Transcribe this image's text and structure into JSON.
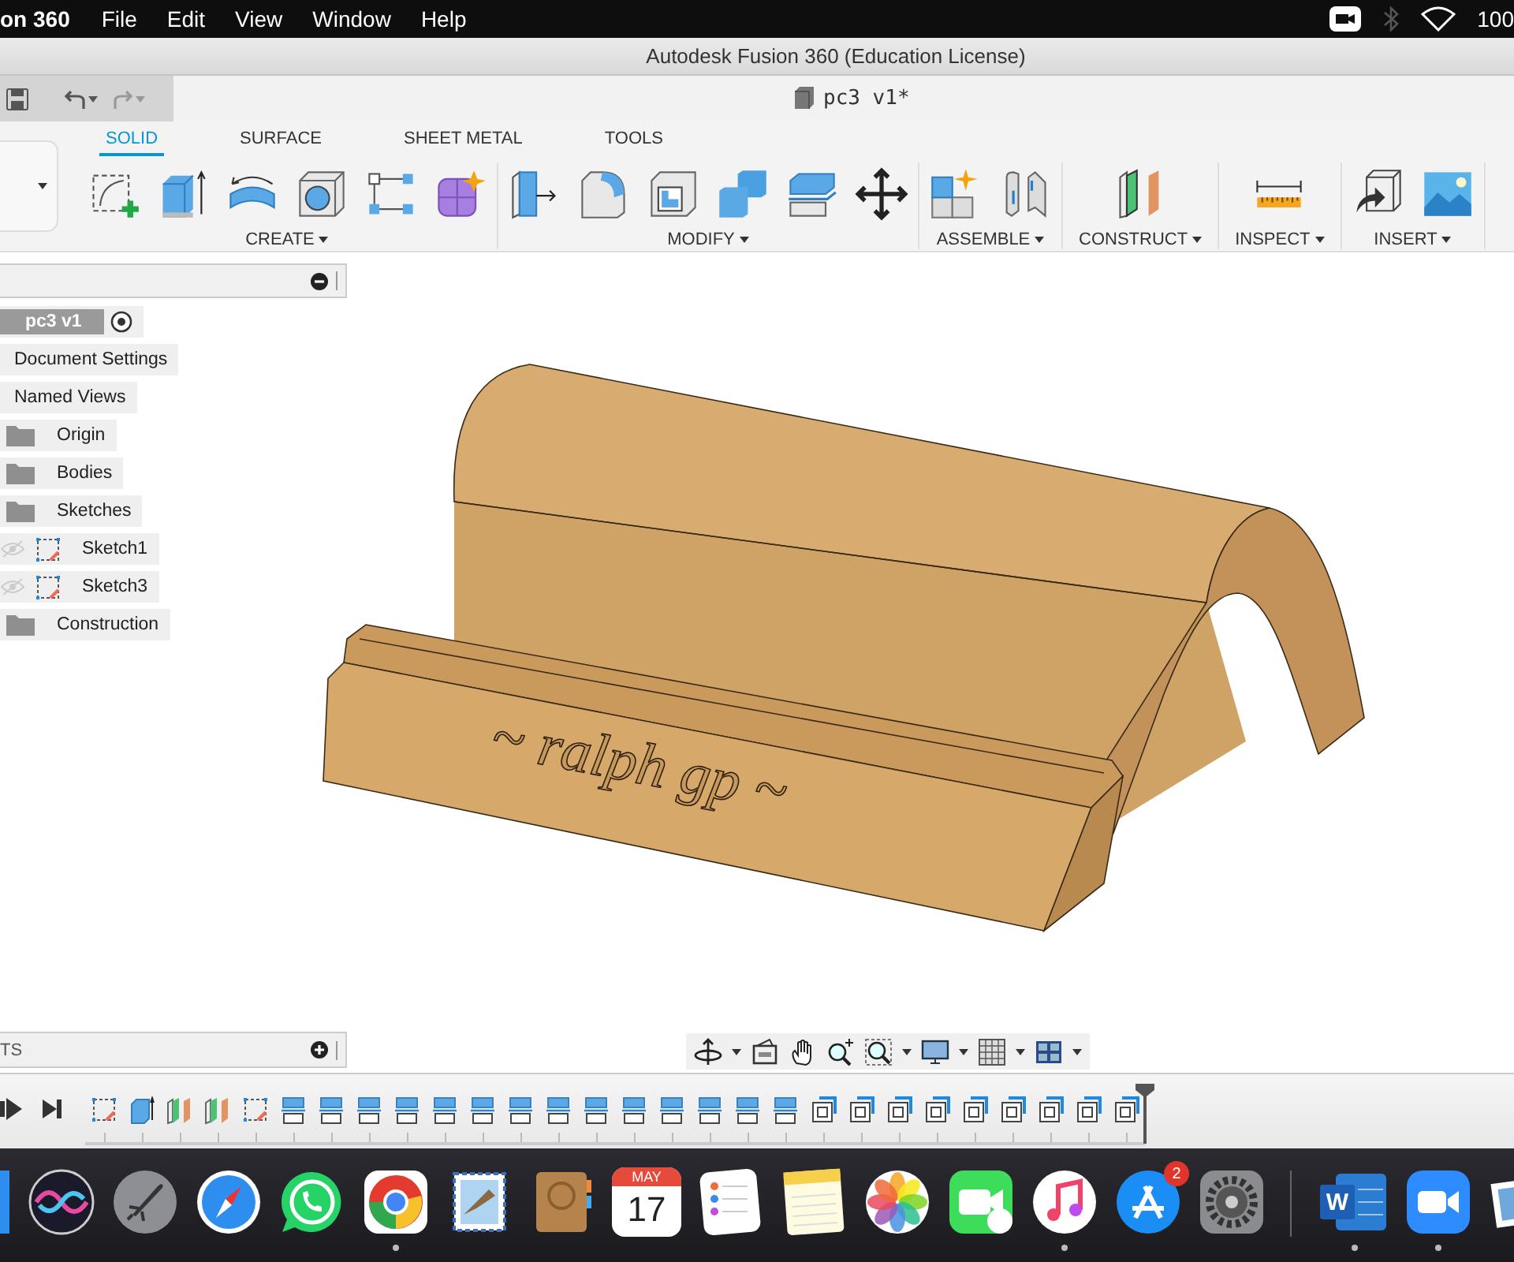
{
  "menu_bar": {
    "app_name": "on 360",
    "menus": [
      "File",
      "Edit",
      "View",
      "Window",
      "Help"
    ],
    "battery": "100"
  },
  "window": {
    "title": "Autodesk Fusion 360 (Education License)"
  },
  "document_tab": {
    "title": "pc3 v1*"
  },
  "toolbar": {
    "tabs": [
      {
        "label": "SOLID",
        "selected": true
      },
      {
        "label": "SURFACE",
        "selected": false
      },
      {
        "label": "SHEET METAL",
        "selected": false
      },
      {
        "label": "TOOLS",
        "selected": false
      }
    ],
    "groups": [
      "CREATE",
      "MODIFY",
      "ASSEMBLE",
      "CONSTRUCT",
      "INSPECT",
      "INSERT"
    ]
  },
  "browser": {
    "root": {
      "label": "pc3 v1",
      "active": true
    },
    "items": [
      {
        "label": "Document Settings",
        "kind": "settings"
      },
      {
        "label": "Named Views",
        "kind": "settings"
      },
      {
        "label": "Origin",
        "kind": "folder"
      },
      {
        "label": "Bodies",
        "kind": "folder"
      },
      {
        "label": "Sketches",
        "kind": "folder",
        "children": [
          {
            "label": "Sketch1",
            "kind": "sketch",
            "visible": false
          },
          {
            "label": "Sketch3",
            "kind": "sketch",
            "visible": false
          }
        ]
      },
      {
        "label": "Construction",
        "kind": "folder"
      }
    ]
  },
  "viewport": {
    "engraving": "~ ralph gp ~"
  },
  "comments": {
    "label": "TS"
  },
  "timeline": {
    "features": [
      {
        "kind": "sketch"
      },
      {
        "kind": "extrude"
      },
      {
        "kind": "plane"
      },
      {
        "kind": "plane"
      },
      {
        "kind": "sketch"
      },
      {
        "kind": "face"
      },
      {
        "kind": "face"
      },
      {
        "kind": "face"
      },
      {
        "kind": "face"
      },
      {
        "kind": "face"
      },
      {
        "kind": "face"
      },
      {
        "kind": "face"
      },
      {
        "kind": "face"
      },
      {
        "kind": "face"
      },
      {
        "kind": "face"
      },
      {
        "kind": "face"
      },
      {
        "kind": "face"
      },
      {
        "kind": "face"
      },
      {
        "kind": "face"
      },
      {
        "kind": "combine"
      },
      {
        "kind": "combine"
      },
      {
        "kind": "combine"
      },
      {
        "kind": "combine"
      },
      {
        "kind": "combine"
      },
      {
        "kind": "combine"
      },
      {
        "kind": "combine"
      },
      {
        "kind": "combine"
      },
      {
        "kind": "combine"
      }
    ]
  },
  "dock": {
    "items": [
      {
        "kind": "finder",
        "running": false
      },
      {
        "kind": "siri",
        "running": false
      },
      {
        "kind": "launchpad",
        "running": false
      },
      {
        "kind": "safari",
        "running": false
      },
      {
        "kind": "whatsapp",
        "running": false
      },
      {
        "kind": "chrome",
        "running": true
      },
      {
        "kind": "mail",
        "running": false
      },
      {
        "kind": "contacts",
        "running": false
      },
      {
        "kind": "calendar",
        "month": "MAY",
        "day": "17",
        "running": false
      },
      {
        "kind": "reminders",
        "running": false
      },
      {
        "kind": "notes",
        "running": false
      },
      {
        "kind": "photos",
        "running": false
      },
      {
        "kind": "facetime",
        "running": false
      },
      {
        "kind": "music",
        "running": true
      },
      {
        "kind": "appstore",
        "badge": "2",
        "running": false
      },
      {
        "kind": "sysprefs",
        "running": false
      },
      {
        "kind": "separator"
      },
      {
        "kind": "word",
        "letter": "W",
        "running": true
      },
      {
        "kind": "zoom",
        "running": true
      },
      {
        "kind": "preview",
        "running": false
      }
    ]
  }
}
